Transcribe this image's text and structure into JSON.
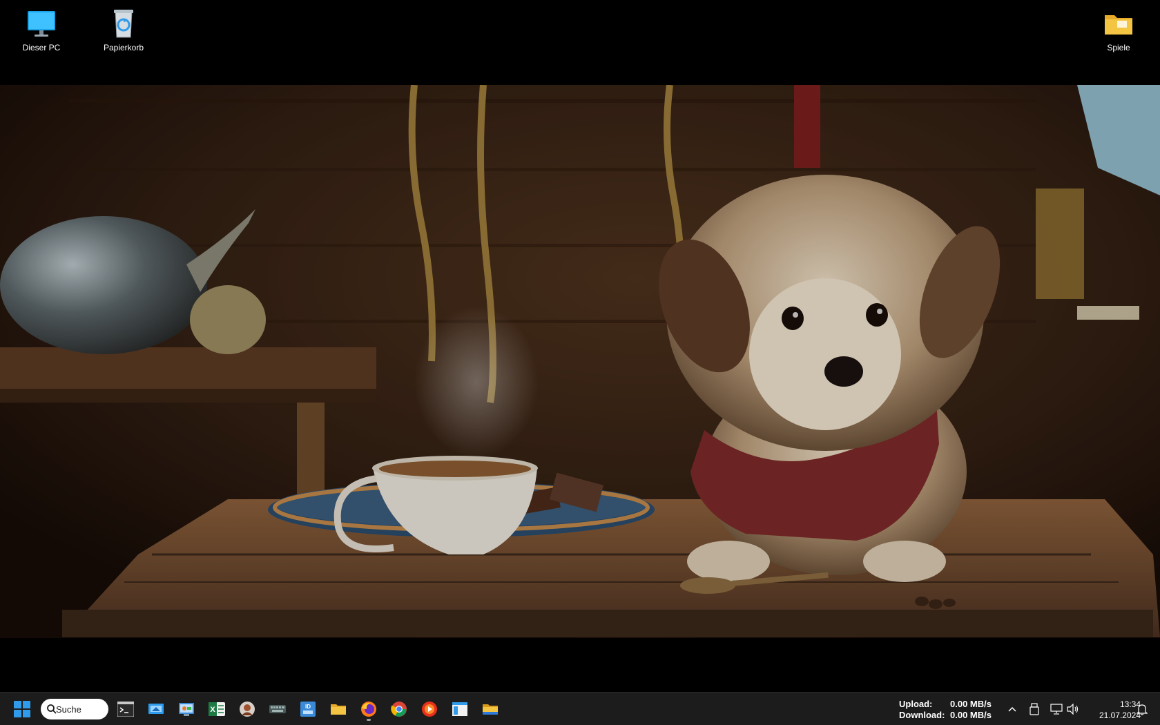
{
  "desktop": {
    "icons": [
      {
        "label": "Dieser PC"
      },
      {
        "label": "Papierkorb"
      },
      {
        "label": "Spiele"
      }
    ]
  },
  "taskbar": {
    "search": {
      "label": "Suche"
    },
    "apps": [
      {
        "icon": "terminal-icon"
      },
      {
        "icon": "remote-desktop-icon"
      },
      {
        "icon": "control-panel-icon"
      },
      {
        "icon": "excel-icon"
      },
      {
        "icon": "user-profile-app-icon"
      },
      {
        "icon": "keyboard-icon"
      },
      {
        "icon": "id-app-icon"
      },
      {
        "icon": "file-explorer-icon"
      },
      {
        "icon": "firefox-icon"
      },
      {
        "icon": "chrome-icon"
      },
      {
        "icon": "media-player-icon"
      },
      {
        "icon": "window-app-icon"
      },
      {
        "icon": "folder-icon"
      }
    ],
    "net_monitor": {
      "upload_label": "Upload:",
      "upload_value": "0.00 MB/s",
      "download_label": "Download:",
      "download_value": "0.00 MB/s"
    },
    "clock": {
      "time": "13:34",
      "date": "21.07.2024"
    }
  },
  "colors": {
    "taskbar_bg": "#1c1c1c",
    "windows_blue": "#2f9bea",
    "folder_yellow": "#f4c542"
  }
}
